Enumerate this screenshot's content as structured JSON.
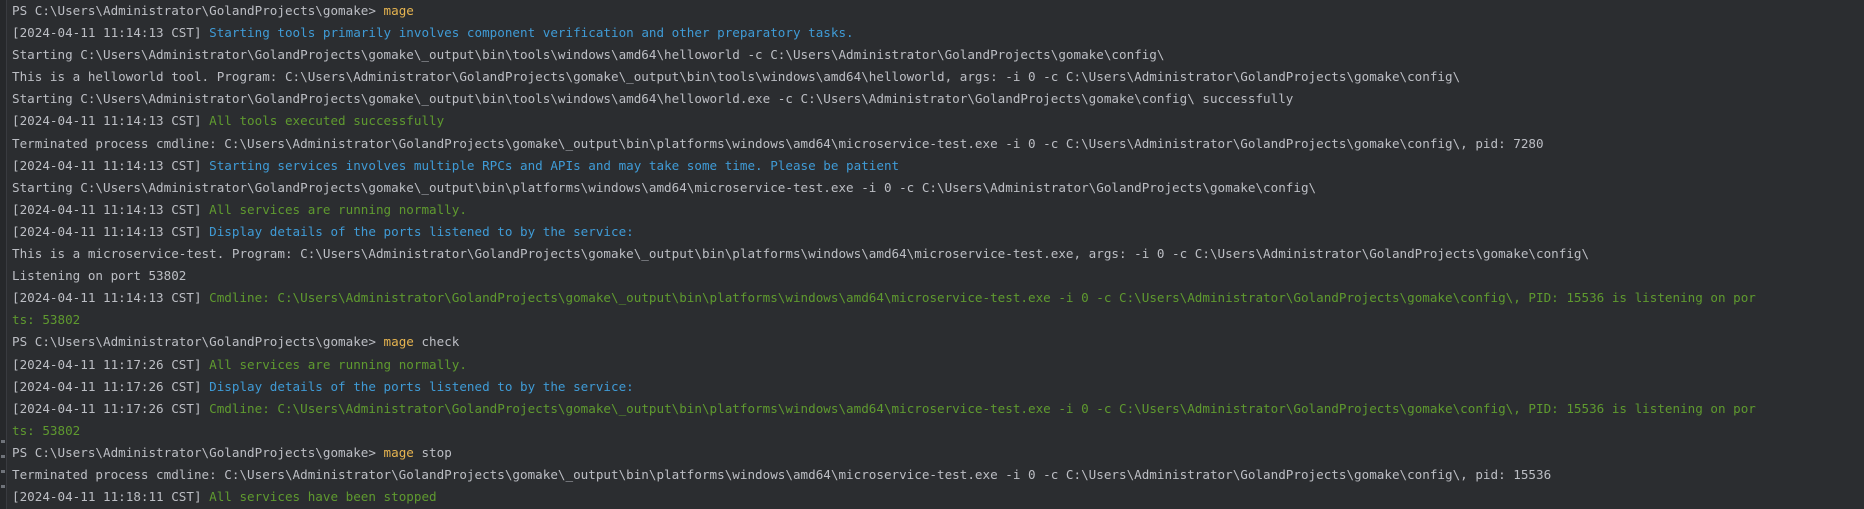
{
  "colors": {
    "background": "#2b2d30",
    "text_default": "#bcbec4",
    "command": "#e6b450",
    "info": "#3f9bd6",
    "success": "#5f9a2f"
  },
  "lines": [
    [
      {
        "t": "PS C:\\Users\\Administrator\\GolandProjects\\gomake> ",
        "c": "default"
      },
      {
        "t": "mage",
        "c": "cmd"
      }
    ],
    [
      {
        "t": "[2024-04-11 11:14:13 CST] ",
        "c": "default"
      },
      {
        "t": "Starting tools primarily involves component verification and other preparatory tasks.",
        "c": "info"
      }
    ],
    [
      {
        "t": "Starting C:\\Users\\Administrator\\GolandProjects\\gomake\\_output\\bin\\tools\\windows\\amd64\\helloworld -c C:\\Users\\Administrator\\GolandProjects\\gomake\\config\\",
        "c": "default"
      }
    ],
    [
      {
        "t": "This is a helloworld tool. Program: C:\\Users\\Administrator\\GolandProjects\\gomake\\_output\\bin\\tools\\windows\\amd64\\helloworld, args: -i 0 -c C:\\Users\\Administrator\\GolandProjects\\gomake\\config\\",
        "c": "default"
      }
    ],
    [
      {
        "t": "Starting C:\\Users\\Administrator\\GolandProjects\\gomake\\_output\\bin\\tools\\windows\\amd64\\helloworld.exe -c C:\\Users\\Administrator\\GolandProjects\\gomake\\config\\ successfully",
        "c": "default"
      }
    ],
    [
      {
        "t": "[2024-04-11 11:14:13 CST] ",
        "c": "default"
      },
      {
        "t": "All tools executed successfully",
        "c": "success"
      }
    ],
    [
      {
        "t": "Terminated process cmdline: C:\\Users\\Administrator\\GolandProjects\\gomake\\_output\\bin\\platforms\\windows\\amd64\\microservice-test.exe -i 0 -c C:\\Users\\Administrator\\GolandProjects\\gomake\\config\\, pid: 7280",
        "c": "default"
      }
    ],
    [
      {
        "t": "[2024-04-11 11:14:13 CST] ",
        "c": "default"
      },
      {
        "t": "Starting services involves multiple RPCs and APIs and may take some time. Please be patient",
        "c": "info"
      }
    ],
    [
      {
        "t": "Starting C:\\Users\\Administrator\\GolandProjects\\gomake\\_output\\bin\\platforms\\windows\\amd64\\microservice-test.exe -i 0 -c C:\\Users\\Administrator\\GolandProjects\\gomake\\config\\",
        "c": "default"
      }
    ],
    [
      {
        "t": "[2024-04-11 11:14:13 CST] ",
        "c": "default"
      },
      {
        "t": "All services are running normally.",
        "c": "success"
      }
    ],
    [
      {
        "t": "[2024-04-11 11:14:13 CST] ",
        "c": "default"
      },
      {
        "t": "Display details of the ports listened to by the service:",
        "c": "info"
      }
    ],
    [
      {
        "t": "This is a microservice-test. Program: C:\\Users\\Administrator\\GolandProjects\\gomake\\_output\\bin\\platforms\\windows\\amd64\\microservice-test.exe, args: -i 0 -c C:\\Users\\Administrator\\GolandProjects\\gomake\\config\\",
        "c": "default"
      }
    ],
    [
      {
        "t": "Listening on port 53802",
        "c": "default"
      }
    ],
    [
      {
        "t": "[2024-04-11 11:14:13 CST] ",
        "c": "default"
      },
      {
        "t": "Cmdline: C:\\Users\\Administrator\\GolandProjects\\gomake\\_output\\bin\\platforms\\windows\\amd64\\microservice-test.exe -i 0 -c C:\\Users\\Administrator\\GolandProjects\\gomake\\config\\, PID: 15536 is listening on por",
        "c": "success"
      }
    ],
    [
      {
        "t": "ts: 53802",
        "c": "success"
      }
    ],
    [
      {
        "t": "PS C:\\Users\\Administrator\\GolandProjects\\gomake> ",
        "c": "default"
      },
      {
        "t": "mage",
        "c": "cmd"
      },
      {
        "t": " check",
        "c": "default"
      }
    ],
    [
      {
        "t": "[2024-04-11 11:17:26 CST] ",
        "c": "default"
      },
      {
        "t": "All services are running normally.",
        "c": "success"
      }
    ],
    [
      {
        "t": "[2024-04-11 11:17:26 CST] ",
        "c": "default"
      },
      {
        "t": "Display details of the ports listened to by the service:",
        "c": "info"
      }
    ],
    [
      {
        "t": "[2024-04-11 11:17:26 CST] ",
        "c": "default"
      },
      {
        "t": "Cmdline: C:\\Users\\Administrator\\GolandProjects\\gomake\\_output\\bin\\platforms\\windows\\amd64\\microservice-test.exe -i 0 -c C:\\Users\\Administrator\\GolandProjects\\gomake\\config\\, PID: 15536 is listening on por",
        "c": "success"
      }
    ],
    [
      {
        "t": "ts: 53802",
        "c": "success"
      }
    ],
    [
      {
        "t": "PS C:\\Users\\Administrator\\GolandProjects\\gomake> ",
        "c": "default"
      },
      {
        "t": "mage",
        "c": "cmd"
      },
      {
        "t": " stop",
        "c": "default"
      }
    ],
    [
      {
        "t": "Terminated process cmdline: C:\\Users\\Administrator\\GolandProjects\\gomake\\_output\\bin\\platforms\\windows\\amd64\\microservice-test.exe -i 0 -c C:\\Users\\Administrator\\GolandProjects\\gomake\\config\\, pid: 15536",
        "c": "default"
      }
    ],
    [
      {
        "t": "[2024-04-11 11:18:11 CST] ",
        "c": "default"
      },
      {
        "t": "All services have been stopped",
        "c": "success"
      }
    ]
  ]
}
